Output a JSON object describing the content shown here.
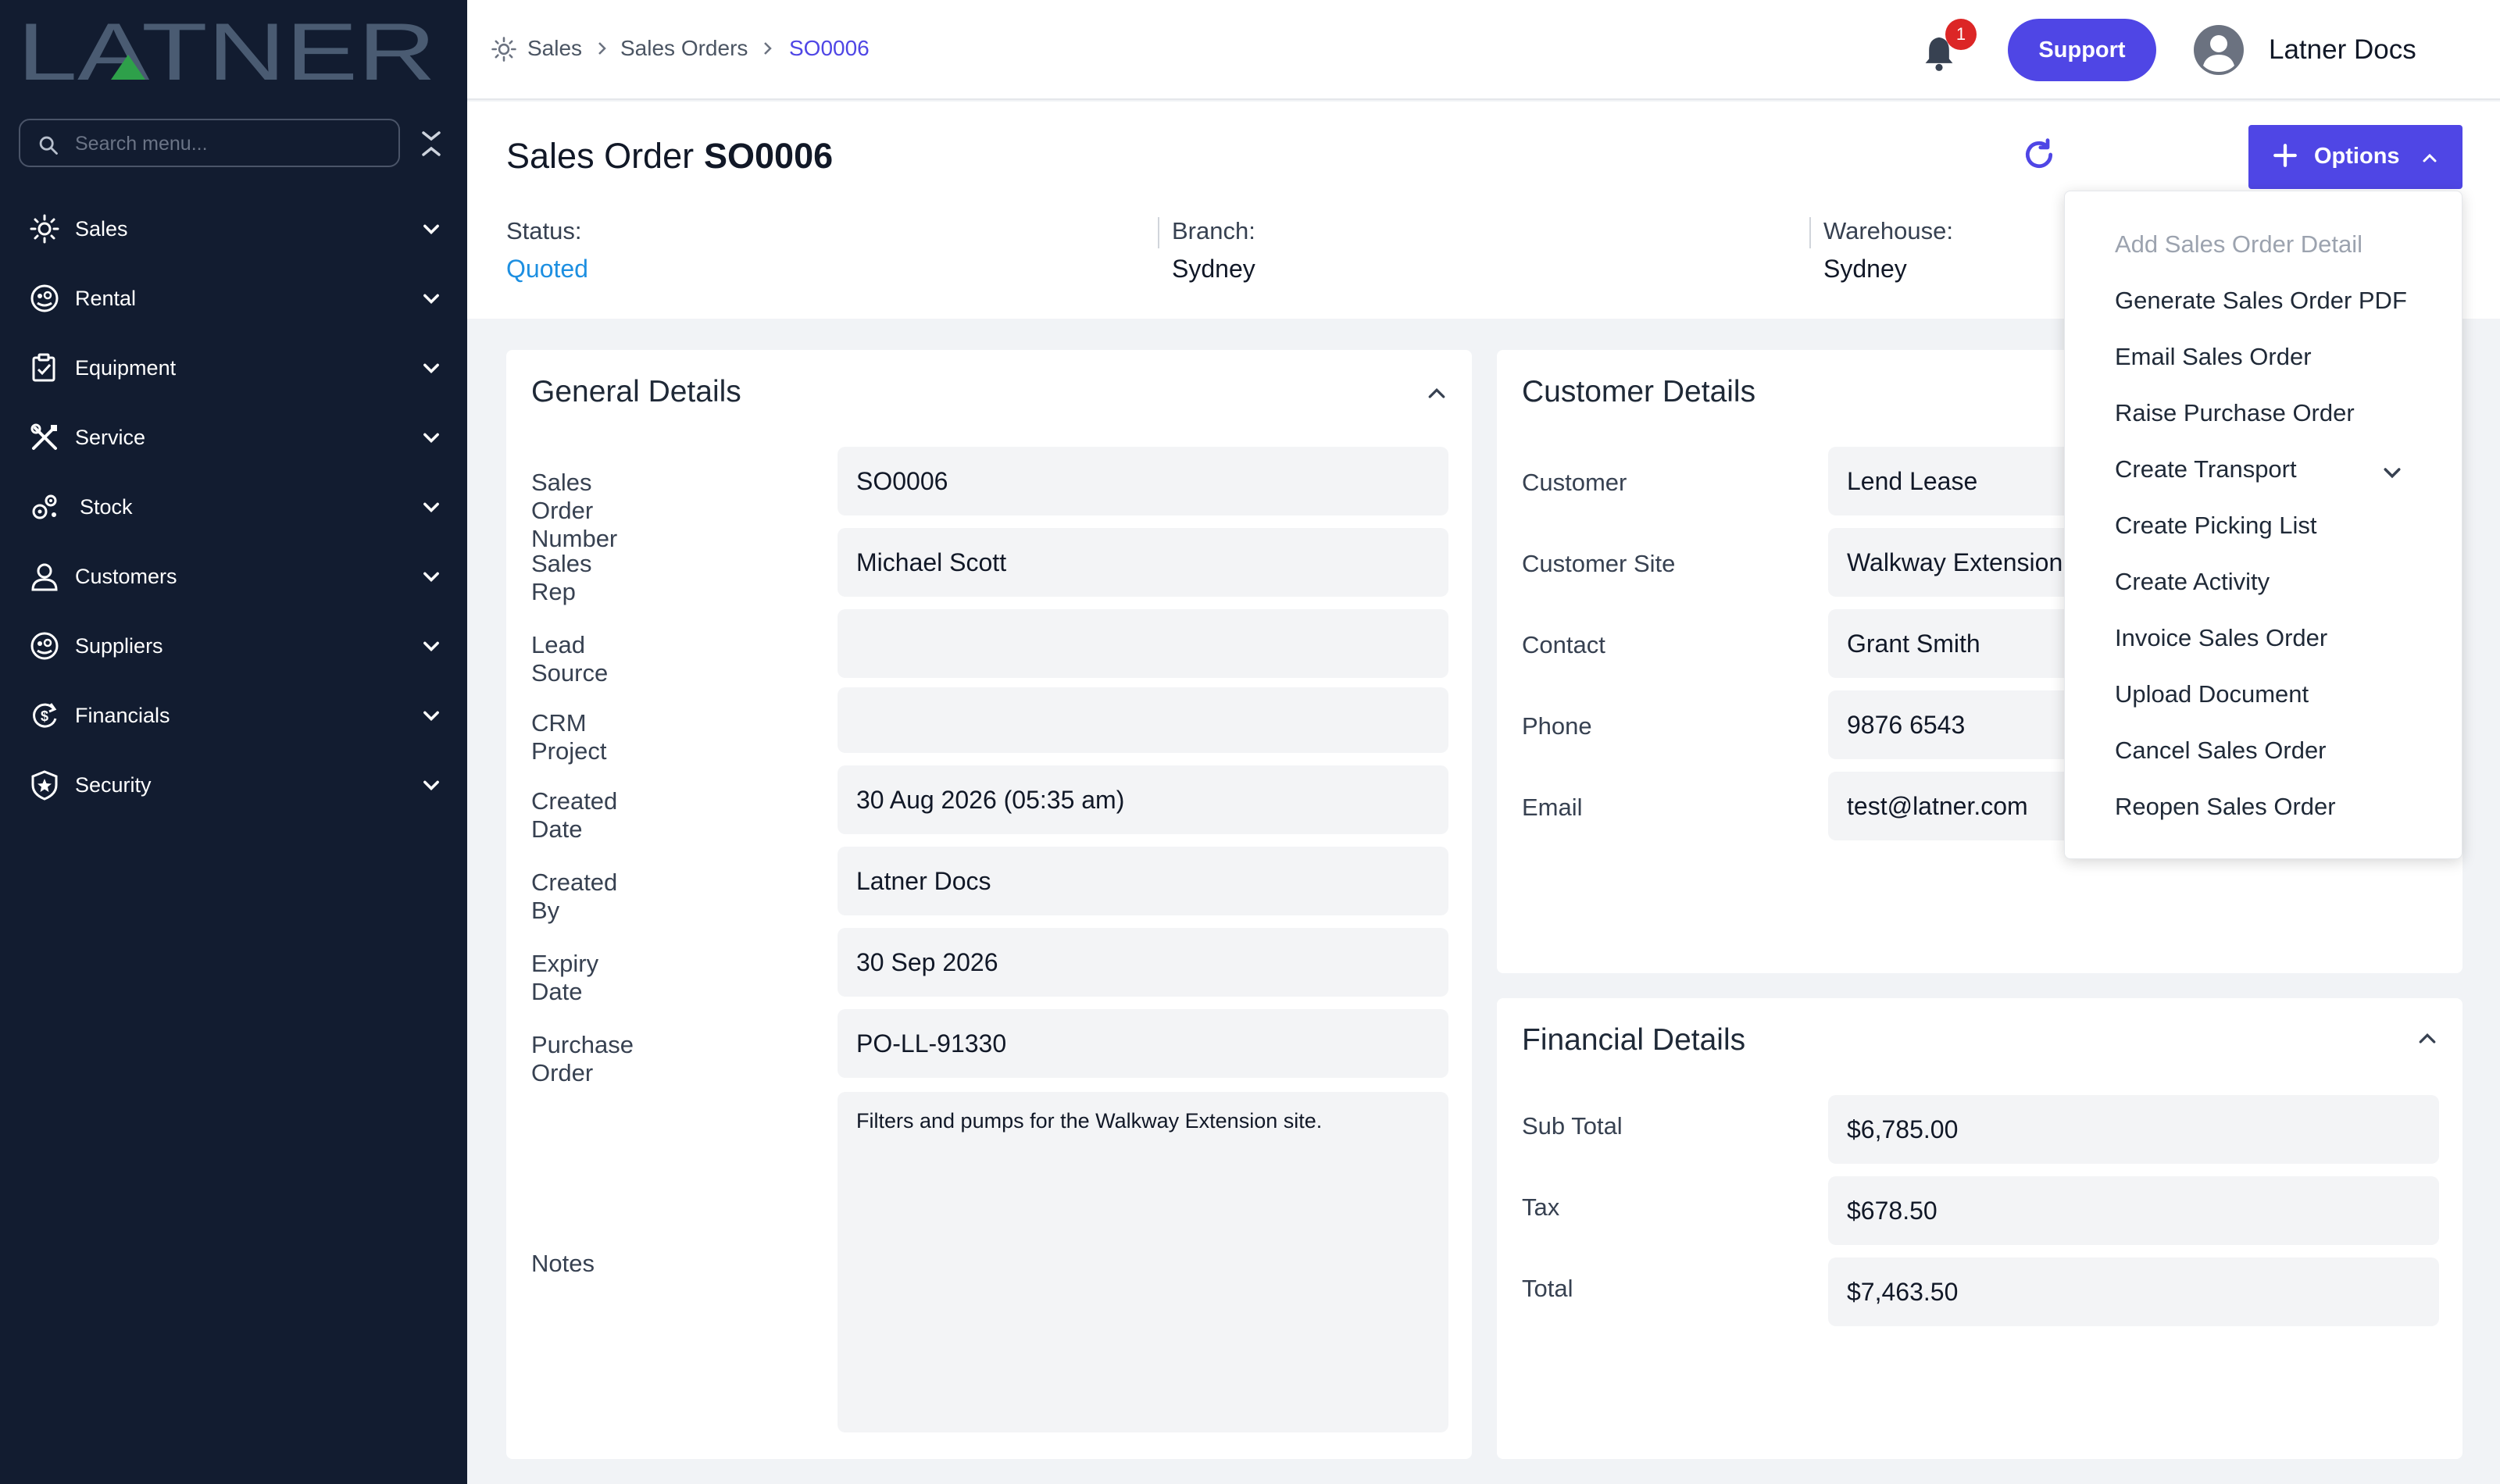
{
  "brand": {
    "logo_text": "LATNER",
    "colors": {
      "sidebar": "#121c30",
      "accent": "#4f46e5",
      "logo": "#4a5b72",
      "logo_green": "#2ea04a",
      "status": "#1d8fe1"
    }
  },
  "sidebar": {
    "search_placeholder": "Search menu...",
    "items": [
      {
        "label": "Sales",
        "icon": "sun-gear-icon"
      },
      {
        "label": "Rental",
        "icon": "face-badge-icon"
      },
      {
        "label": "Equipment",
        "icon": "clipboard-check-icon"
      },
      {
        "label": "Service",
        "icon": "wrench-screwdriver-icon"
      },
      {
        "label": "Stock",
        "icon": "cogs-icon"
      },
      {
        "label": "Customers",
        "icon": "person-icon"
      },
      {
        "label": "Suppliers",
        "icon": "face-badge-icon"
      },
      {
        "label": "Financials",
        "icon": "dollar-cycle-icon"
      },
      {
        "label": "Security",
        "icon": "shield-star-icon"
      }
    ]
  },
  "topbar": {
    "breadcrumb": [
      "Sales",
      "Sales Orders",
      "SO0006"
    ],
    "notification_count": "1",
    "support_label": "Support",
    "user_name": "Latner Docs"
  },
  "header": {
    "title_label": "Sales Order",
    "title_value": "SO0006",
    "options_label": "Options",
    "status_label": "Status:",
    "status_value": "Quoted",
    "branch_label": "Branch:",
    "branch_value": "Sydney",
    "warehouse_label": "Warehouse:",
    "warehouse_value": "Sydney"
  },
  "general": {
    "title": "General Details",
    "fields": [
      {
        "label": "Sales Order Number",
        "value": "SO0006"
      },
      {
        "label": "Sales Rep",
        "value": "Michael Scott"
      },
      {
        "label": "Lead Source",
        "value": ""
      },
      {
        "label": "CRM Project",
        "value": ""
      },
      {
        "label": "Created Date",
        "value": "30 Aug 2026 (05:35 am)"
      },
      {
        "label": "Created By",
        "value": "Latner Docs"
      },
      {
        "label": "Expiry Date",
        "value": "30 Sep 2026"
      },
      {
        "label": "Purchase Order",
        "value": "PO-LL-91330"
      }
    ],
    "notes_label": "Notes",
    "notes_value": "Filters and pumps for the Walkway Extension site."
  },
  "customer": {
    "title": "Customer Details",
    "fields": [
      {
        "label": "Customer",
        "value": "Lend Lease"
      },
      {
        "label": "Customer Site",
        "value": "Walkway Extension"
      },
      {
        "label": "Contact",
        "value": "Grant Smith"
      },
      {
        "label": "Phone",
        "value": "9876 6543"
      },
      {
        "label": "Email",
        "value": "test@latner.com"
      }
    ]
  },
  "financial": {
    "title": "Financial Details",
    "fields": [
      {
        "label": "Sub Total",
        "value": "$6,785.00"
      },
      {
        "label": "Tax",
        "value": "$678.50"
      },
      {
        "label": "Total",
        "value": "$7,463.50"
      }
    ]
  },
  "options_menu": {
    "items": [
      {
        "label": "Add Sales Order Detail",
        "disabled": true
      },
      {
        "label": "Generate Sales Order PDF"
      },
      {
        "label": "Email Sales Order"
      },
      {
        "label": "Raise Purchase Order"
      },
      {
        "label": "Create Transport",
        "has_submenu": true
      },
      {
        "label": "Create Picking List"
      },
      {
        "label": "Create Activity"
      },
      {
        "label": "Invoice Sales Order"
      },
      {
        "label": "Upload Document"
      },
      {
        "label": "Cancel Sales Order"
      },
      {
        "label": "Reopen Sales Order"
      }
    ]
  }
}
